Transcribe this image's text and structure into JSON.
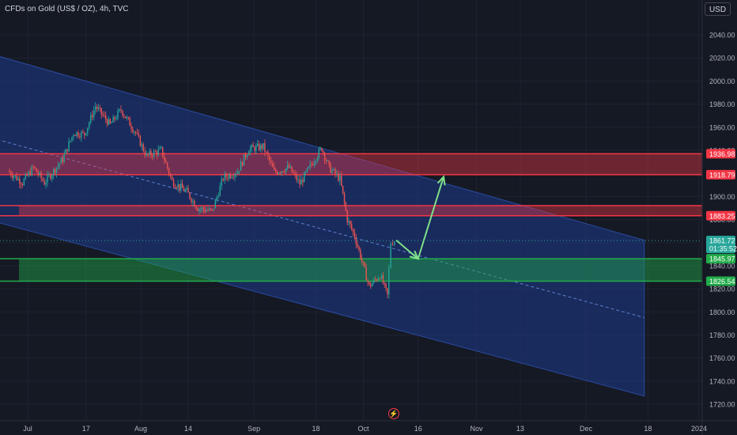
{
  "title": "CFDs on Gold (US$ / OZ), 4h, TVC",
  "currency_label": "USD",
  "bolt_icon": "lightning-bolt-icon",
  "colors": {
    "background": "#151924",
    "up_candle": "#26a69a",
    "down_candle": "#ef5350",
    "channel_fill": "#1e3a8a",
    "resistance_zone": "#f23645",
    "support_zone": "#22ab4a",
    "arrow": "#7ee08a",
    "midline": "#5b7fcf"
  },
  "chart_data": {
    "type": "candlestick",
    "instrument": "CFDs on Gold (US$ / OZ)",
    "timeframe": "4h",
    "source": "TVC",
    "y_ticks": [
      2040,
      2020,
      2000,
      1980,
      1960,
      1940,
      1920,
      1900,
      1880,
      1860,
      1840,
      1820,
      1800,
      1780,
      1760,
      1740,
      1720
    ],
    "y_tick_labels": [
      "2040.00",
      "2020.00",
      "2000.00",
      "1980.00",
      "1960.00",
      "1940.00",
      "1920.00",
      "1900.00",
      "1880.00",
      "1860.00",
      "1840.00",
      "1820.00",
      "1800.00",
      "1780.00",
      "1760.00",
      "1740.00",
      "1720.00"
    ],
    "x_ticks": [
      {
        "label": "Jul",
        "date": "2023-07-01"
      },
      {
        "label": "17",
        "date": "2023-07-17"
      },
      {
        "label": "Aug",
        "date": "2023-08-01"
      },
      {
        "label": "14",
        "date": "2023-08-14"
      },
      {
        "label": "Sep",
        "date": "2023-09-01"
      },
      {
        "label": "18",
        "date": "2023-09-18"
      },
      {
        "label": "Oct",
        "date": "2023-10-01"
      },
      {
        "label": "16",
        "date": "2023-10-16"
      },
      {
        "label": "Nov",
        "date": "2023-11-01"
      },
      {
        "label": "13",
        "date": "2023-11-13"
      },
      {
        "label": "Dec",
        "date": "2023-12-01"
      },
      {
        "label": "18",
        "date": "2023-12-18"
      },
      {
        "label": "2024",
        "date": "2024-01-01"
      }
    ],
    "price_path": [
      [
        "2023-06-26",
        1922
      ],
      [
        "2023-06-30",
        1912
      ],
      [
        "2023-07-03",
        1925
      ],
      [
        "2023-07-06",
        1912
      ],
      [
        "2023-07-11",
        1932
      ],
      [
        "2023-07-14",
        1955
      ],
      [
        "2023-07-17",
        1954
      ],
      [
        "2023-07-20",
        1978
      ],
      [
        "2023-07-24",
        1962
      ],
      [
        "2023-07-27",
        1975
      ],
      [
        "2023-07-31",
        1955
      ],
      [
        "2023-08-03",
        1935
      ],
      [
        "2023-08-07",
        1940
      ],
      [
        "2023-08-10",
        1913
      ],
      [
        "2023-08-14",
        1904
      ],
      [
        "2023-08-17",
        1890
      ],
      [
        "2023-08-21",
        1887
      ],
      [
        "2023-08-24",
        1916
      ],
      [
        "2023-08-28",
        1922
      ],
      [
        "2023-08-31",
        1941
      ],
      [
        "2023-09-04",
        1943
      ],
      [
        "2023-09-07",
        1921
      ],
      [
        "2023-09-11",
        1925
      ],
      [
        "2023-09-14",
        1911
      ],
      [
        "2023-09-18",
        1932
      ],
      [
        "2023-09-20",
        1942
      ],
      [
        "2023-09-22",
        1925
      ],
      [
        "2023-09-25",
        1915
      ],
      [
        "2023-09-27",
        1880
      ],
      [
        "2023-09-29",
        1866
      ],
      [
        "2023-10-03",
        1822
      ],
      [
        "2023-10-06",
        1832
      ],
      [
        "2023-10-08",
        1814
      ],
      [
        "2023-10-09",
        1860
      ],
      [
        "2023-10-10",
        1861.72
      ]
    ],
    "channel": {
      "upper": [
        [
          "2023-06-08",
          2035
        ],
        [
          "2023-12-17",
          1862
        ]
      ],
      "lower": [
        [
          "2023-06-08",
          1890
        ],
        [
          "2023-12-17",
          1727
        ]
      ],
      "midline": [
        [
          "2023-06-08",
          1962
        ],
        [
          "2023-12-17",
          1795
        ]
      ]
    },
    "zones": [
      {
        "kind": "resistance",
        "top": 1936.98,
        "bottom": 1918.79,
        "label_top": "1936.98",
        "label_bottom": "1918.79"
      },
      {
        "kind": "resistance",
        "top": 1892,
        "bottom": 1883.25,
        "label_bottom": "1883.25"
      },
      {
        "kind": "support",
        "top": 1845.97,
        "bottom": 1826.54,
        "label_top": "1845.97",
        "label_bottom": "1826.54"
      }
    ],
    "projection_arrow": [
      [
        "2023-10-10",
        1862
      ],
      [
        "2023-10-16",
        1846
      ],
      [
        "2023-10-23",
        1917
      ]
    ],
    "last_price": {
      "value": 1861.72,
      "label": "1861.72",
      "countdown": "01:35:52"
    }
  }
}
